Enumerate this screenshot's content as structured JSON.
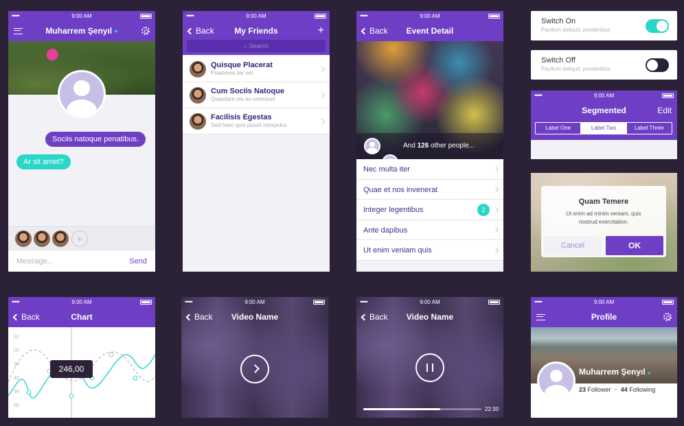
{
  "colors": {
    "accent": "#6e3ec5",
    "teal": "#2ad6c8",
    "bg": "#2b2238"
  },
  "status": {
    "time": "9:00 AM",
    "signal": "•••••"
  },
  "chat": {
    "title": "Muharrem Şenyıl",
    "msg_out": "Sociis natoque penatibus.",
    "msg_in": "Ar sit amet?",
    "input_placeholder": "Message...",
    "send": "Send",
    "add": "+"
  },
  "friends": {
    "back": "Back",
    "title": "My Friends",
    "add": "+",
    "search": "Search",
    "items": [
      {
        "name": "Quisque Placerat",
        "sub": "Praeterea iter est"
      },
      {
        "name": "Cum Sociis Natoque",
        "sub": "Quasdam res ex communi"
      },
      {
        "name": "Facilisis Egestas",
        "sub": "Sed haec quis possit intrepidus"
      }
    ]
  },
  "event": {
    "back": "Back",
    "title": "Event Detail",
    "people_pre": "And ",
    "people_count": "126",
    "people_post": " other people...",
    "items": [
      "Nec multa iter",
      "Quae et nos invenerat",
      "Integer legentibus",
      "Ante dapibus",
      "Ut enim  veniam quis"
    ],
    "badge": "2"
  },
  "switches": {
    "on_title": "Switch On",
    "on_sub": "Paullum deliquit, ponderibus.",
    "off_title": "Switch Off",
    "off_sub": "Paullum deliquit, ponderibus.",
    "on_state": true,
    "off_state": false
  },
  "segmented": {
    "title": "Segmented",
    "edit": "Edit",
    "labels": [
      "Label One",
      "Label Two",
      "Label Three"
    ],
    "selected": 1
  },
  "alert": {
    "title": "Quam Temere",
    "body": "Ut enim ad minim veniam, quis nostrud exercitation.",
    "cancel": "Cancel",
    "ok": "OK"
  },
  "chart": {
    "back": "Back",
    "title": "Chart",
    "tooltip": "246,00",
    "y_ticks": [
      "10",
      "20",
      "30",
      "40",
      "50",
      "60"
    ]
  },
  "video1": {
    "back": "Back",
    "title": "Video Name"
  },
  "video2": {
    "back": "Back",
    "title": "Video Name",
    "time": "22:30",
    "progress": 0.65
  },
  "profile": {
    "title": "Profile",
    "name": "Muharrem Şenyıl",
    "followers": "23",
    "followers_label": " Follower",
    "dot": "•",
    "following": "44",
    "following_label": " Following"
  }
}
